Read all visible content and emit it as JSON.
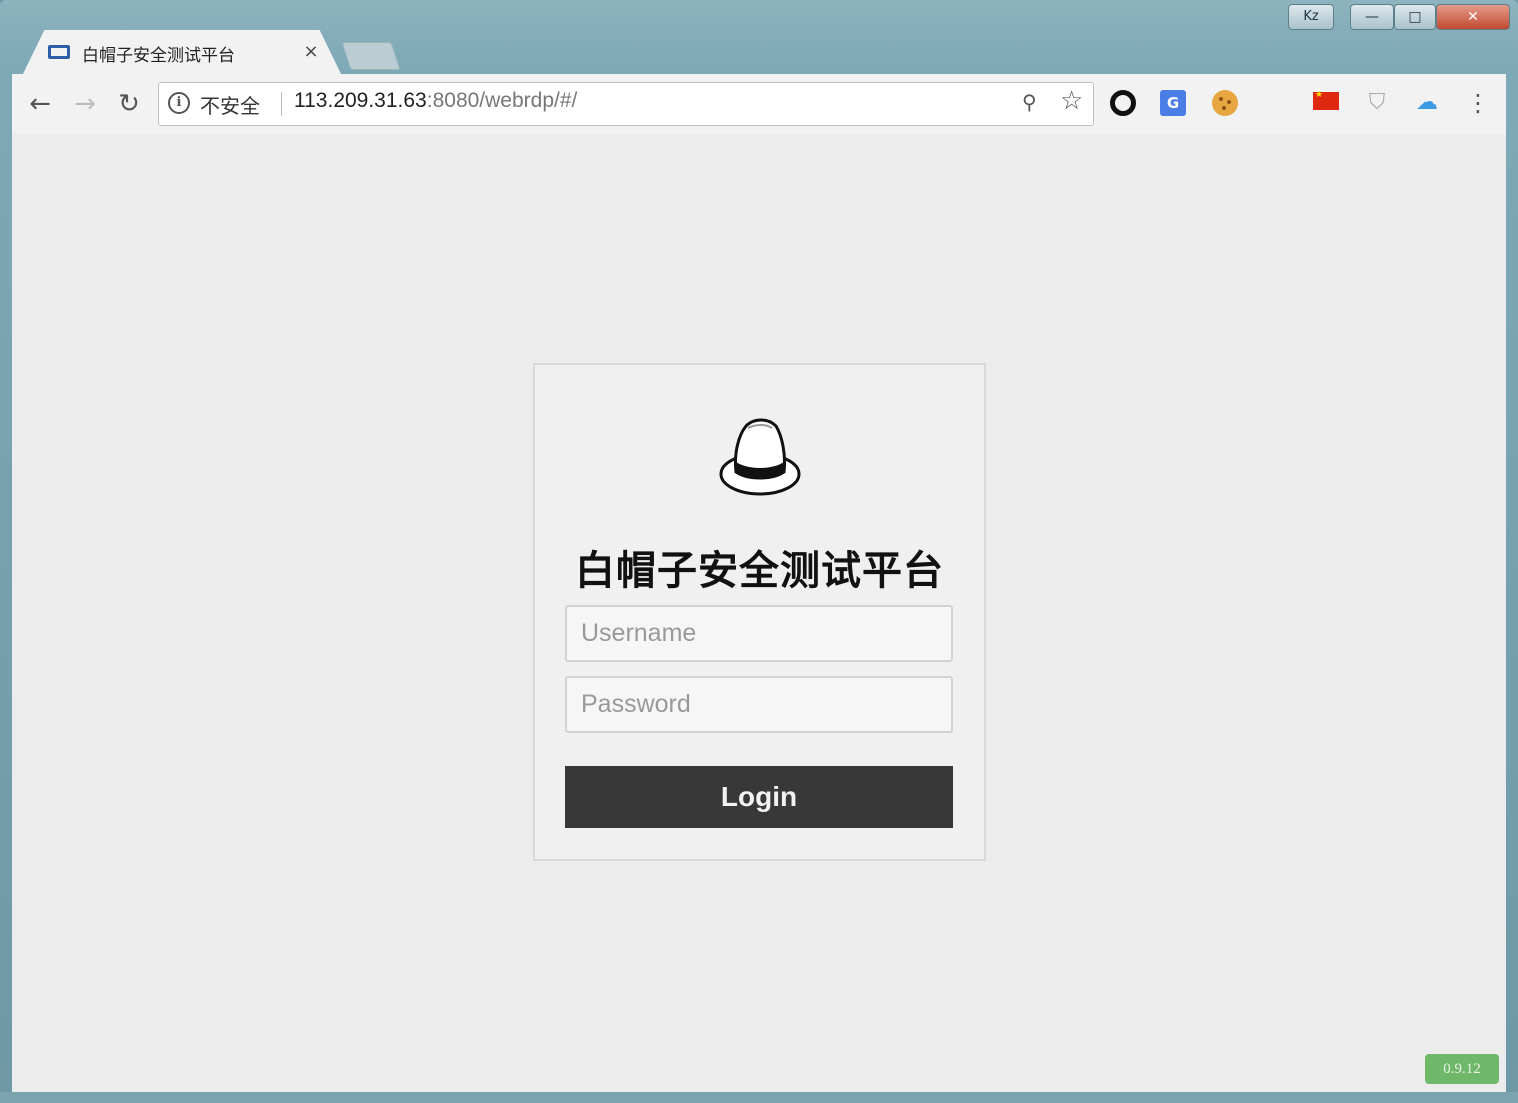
{
  "browser": {
    "tab": {
      "title": "白帽子安全测试平台",
      "close_glyph": "×"
    },
    "window_controls": {
      "profile": "Kz",
      "minimize": "—",
      "maximize": "□",
      "close": "✕"
    },
    "toolbar": {
      "back_glyph": "←",
      "forward_glyph": "→",
      "reload_glyph": "↻",
      "security_label": "不安全",
      "info_glyph": "i",
      "url_host": "113.209.31.63",
      "url_rest": ":8080/webrdp/#/",
      "key_glyph": "⚲",
      "star_glyph": "☆",
      "menu_glyph": "⋮",
      "extensions": [
        "opera-icon",
        "translate-icon",
        "cookie-icon",
        "china-flag-icon",
        "shield-icon",
        "cloud-icon"
      ],
      "translate_glyph": "G",
      "shield_glyph": "⛉",
      "cloud_glyph": "☁"
    }
  },
  "login": {
    "title": "白帽子安全测试平台",
    "username_placeholder": "Username",
    "password_placeholder": "Password",
    "login_label": "Login"
  },
  "version": "0.9.12",
  "colors": {
    "button_bg": "#383838",
    "version_badge": "#6fb86a",
    "window_frame": "#7ea9b6"
  }
}
